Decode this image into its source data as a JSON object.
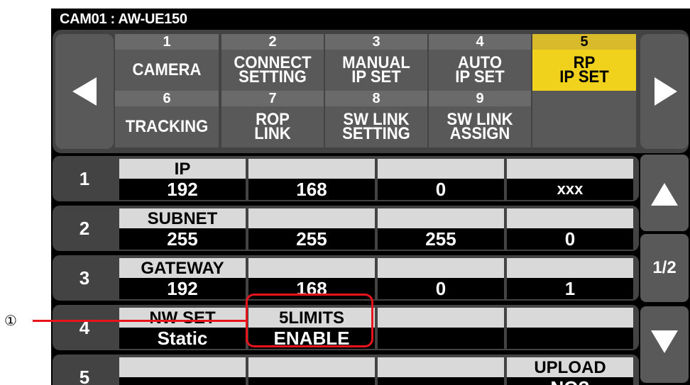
{
  "device": {
    "title": "CAM01 : AW-UE150"
  },
  "tabs": [
    {
      "num": "1",
      "label": [
        "CAMERA"
      ],
      "active": false
    },
    {
      "num": "2",
      "label": [
        "CONNECT",
        "SETTING"
      ],
      "active": false
    },
    {
      "num": "3",
      "label": [
        "MANUAL",
        "IP SET"
      ],
      "active": false
    },
    {
      "num": "4",
      "label": [
        "AUTO",
        "IP SET"
      ],
      "active": false
    },
    {
      "num": "5",
      "label": [
        "RP",
        "IP SET"
      ],
      "active": true
    },
    {
      "num": "6",
      "label": [
        "TRACKING"
      ],
      "active": false
    },
    {
      "num": "7",
      "label": [
        "ROP",
        "LINK"
      ],
      "active": false
    },
    {
      "num": "8",
      "label": [
        "SW LINK",
        "SETTING"
      ],
      "active": false
    },
    {
      "num": "9",
      "label": [
        "SW LINK",
        "ASSIGN"
      ],
      "active": false
    }
  ],
  "rows": [
    {
      "num": "1",
      "cells": [
        {
          "header": "IP",
          "value": "192"
        },
        {
          "header": "",
          "value": "168"
        },
        {
          "header": "",
          "value": "0"
        },
        {
          "header": "",
          "value": "xxx"
        }
      ]
    },
    {
      "num": "2",
      "cells": [
        {
          "header": "SUBNET",
          "value": "255"
        },
        {
          "header": "",
          "value": "255"
        },
        {
          "header": "",
          "value": "255"
        },
        {
          "header": "",
          "value": "0"
        }
      ]
    },
    {
      "num": "3",
      "cells": [
        {
          "header": "GATEWAY",
          "value": "192"
        },
        {
          "header": "",
          "value": "168"
        },
        {
          "header": "",
          "value": "0"
        },
        {
          "header": "",
          "value": "1"
        }
      ]
    },
    {
      "num": "4",
      "cells": [
        {
          "header": "NW SET",
          "value": "Static"
        },
        {
          "header": "5LIMITS",
          "value": "ENABLE"
        },
        {
          "header": "",
          "value": ""
        },
        {
          "header": "",
          "value": ""
        }
      ]
    },
    {
      "num": "5",
      "cells": [
        {
          "header": "",
          "value": ""
        },
        {
          "header": "",
          "value": ""
        },
        {
          "header": "",
          "value": ""
        },
        {
          "header": "UPLOAD",
          "value": "NO?"
        }
      ]
    }
  ],
  "pager": {
    "indicator": "1/2"
  },
  "callout": {
    "label": "①"
  },
  "icons": {
    "prev_tabs": "triangle-left-icon",
    "next_tabs": "triangle-right-icon",
    "scroll_up": "triangle-up-icon",
    "scroll_down": "triangle-down-icon"
  },
  "colors": {
    "active_tab": "#f0d21c",
    "callout": "#e8141c",
    "cell_header": "#d9d9d9",
    "button": "#595959",
    "panel": "#434343"
  }
}
